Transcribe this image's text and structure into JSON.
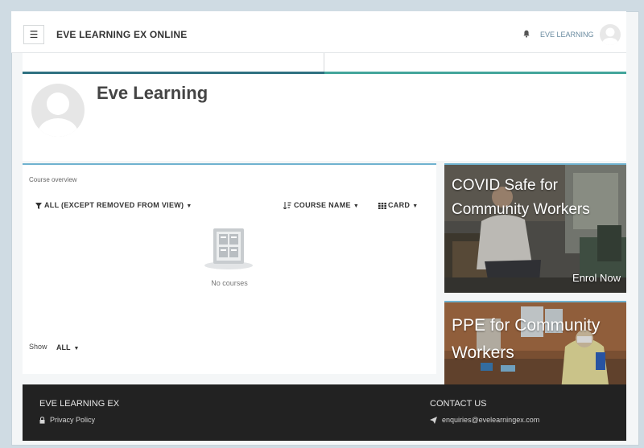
{
  "navbar": {
    "menu_icon": "hamburger-icon",
    "site_title": "EVE LEARNING EX ONLINE",
    "notification_icon": "bell-icon",
    "user_name": "EVE LEARNING"
  },
  "profile": {
    "name": "Eve Learning"
  },
  "course_overview": {
    "block_title": "Course overview",
    "filter_label": "ALL (EXCEPT REMOVED FROM VIEW)",
    "sort_label": "COURSE NAME",
    "view_label": "CARD",
    "empty_text": "No courses",
    "show_label": "Show",
    "show_value": "ALL"
  },
  "promos": [
    {
      "title": "COVID Safe for Community Workers",
      "cta": "Enrol Now"
    },
    {
      "title": "PPE for Community Workers"
    }
  ],
  "footer": {
    "brand": "EVE LEARNING EX",
    "privacy_link": "Privacy Policy",
    "contact_heading": "CONTACT US",
    "email": "enquiries@evelearningex.com"
  },
  "colors": {
    "tab_accent_left": "#2f7181",
    "tab_accent_right": "#43a59b",
    "block_border": "#6fb2cf",
    "footer_bg": "#222222"
  }
}
